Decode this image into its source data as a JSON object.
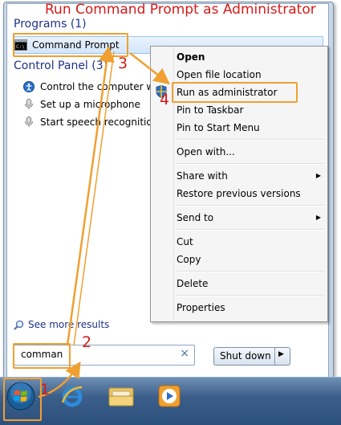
{
  "title": "Run Command Prompt as Administrator",
  "programs": {
    "header": "Programs (1)",
    "items": [
      {
        "label": "Command Prompt",
        "icon": "cmd-icon"
      }
    ]
  },
  "control_panel": {
    "header": "Control Panel (3)",
    "items": [
      {
        "label": "Control the computer with",
        "icon": "accessibility-icon"
      },
      {
        "label": "Set up a microphone",
        "icon": "microphone-icon"
      },
      {
        "label": "Start speech recognition",
        "icon": "microphone-icon"
      }
    ]
  },
  "context_menu": {
    "items": {
      "open": "Open",
      "open_file_location": "Open file location",
      "run_as_admin": "Run as administrator",
      "pin_taskbar": "Pin to Taskbar",
      "pin_start": "Pin to Start Menu",
      "open_with": "Open with...",
      "share_with": "Share with",
      "restore": "Restore previous versions",
      "send_to": "Send to",
      "cut": "Cut",
      "copy": "Copy",
      "delete": "Delete",
      "properties": "Properties"
    }
  },
  "see_more": "See more results",
  "search": {
    "value": "comman"
  },
  "shutdown_label": "Shut down",
  "steps": [
    "1",
    "2",
    "3",
    "4"
  ],
  "colors": {
    "annotation": "#d61a1a",
    "highlight": "#f0a030",
    "header": "#1e3287"
  }
}
